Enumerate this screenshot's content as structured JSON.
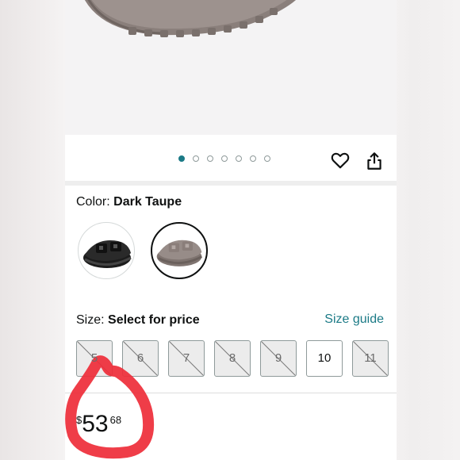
{
  "gallery": {
    "image_count": 7,
    "active_index": 0,
    "favorite_icon": "heart-outline-icon",
    "share_icon": "share-icon"
  },
  "color": {
    "label": "Color:",
    "selected": "Dark Taupe",
    "swatches": [
      {
        "name": "Black",
        "selected": false
      },
      {
        "name": "Dark Taupe",
        "selected": true
      }
    ]
  },
  "size": {
    "label": "Size:",
    "value": "Select for price",
    "guide_link": "Size guide",
    "options": [
      {
        "label": "5",
        "available": false
      },
      {
        "label": "6",
        "available": false
      },
      {
        "label": "7",
        "available": false
      },
      {
        "label": "8",
        "available": false
      },
      {
        "label": "9",
        "available": false
      },
      {
        "label": "10",
        "available": true
      },
      {
        "label": "11",
        "available": false
      }
    ]
  },
  "price": {
    "symbol": "$",
    "whole": "53",
    "fraction": "68"
  },
  "colors": {
    "accent": "#1b7a86",
    "text": "#0f1111",
    "marker": "#ee2e3a"
  }
}
